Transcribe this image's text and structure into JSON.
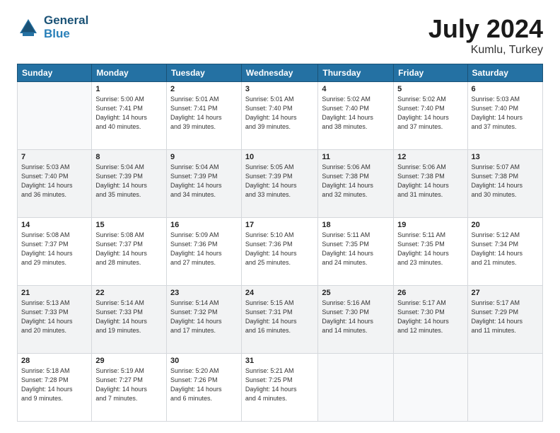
{
  "header": {
    "logo_line1": "General",
    "logo_line2": "Blue",
    "month": "July 2024",
    "location": "Kumlu, Turkey"
  },
  "days_of_week": [
    "Sunday",
    "Monday",
    "Tuesday",
    "Wednesday",
    "Thursday",
    "Friday",
    "Saturday"
  ],
  "weeks": [
    [
      {
        "day": "",
        "info": ""
      },
      {
        "day": "1",
        "info": "Sunrise: 5:00 AM\nSunset: 7:41 PM\nDaylight: 14 hours\nand 40 minutes."
      },
      {
        "day": "2",
        "info": "Sunrise: 5:01 AM\nSunset: 7:41 PM\nDaylight: 14 hours\nand 39 minutes."
      },
      {
        "day": "3",
        "info": "Sunrise: 5:01 AM\nSunset: 7:40 PM\nDaylight: 14 hours\nand 39 minutes."
      },
      {
        "day": "4",
        "info": "Sunrise: 5:02 AM\nSunset: 7:40 PM\nDaylight: 14 hours\nand 38 minutes."
      },
      {
        "day": "5",
        "info": "Sunrise: 5:02 AM\nSunset: 7:40 PM\nDaylight: 14 hours\nand 37 minutes."
      },
      {
        "day": "6",
        "info": "Sunrise: 5:03 AM\nSunset: 7:40 PM\nDaylight: 14 hours\nand 37 minutes."
      }
    ],
    [
      {
        "day": "7",
        "info": "Sunrise: 5:03 AM\nSunset: 7:40 PM\nDaylight: 14 hours\nand 36 minutes."
      },
      {
        "day": "8",
        "info": "Sunrise: 5:04 AM\nSunset: 7:39 PM\nDaylight: 14 hours\nand 35 minutes."
      },
      {
        "day": "9",
        "info": "Sunrise: 5:04 AM\nSunset: 7:39 PM\nDaylight: 14 hours\nand 34 minutes."
      },
      {
        "day": "10",
        "info": "Sunrise: 5:05 AM\nSunset: 7:39 PM\nDaylight: 14 hours\nand 33 minutes."
      },
      {
        "day": "11",
        "info": "Sunrise: 5:06 AM\nSunset: 7:38 PM\nDaylight: 14 hours\nand 32 minutes."
      },
      {
        "day": "12",
        "info": "Sunrise: 5:06 AM\nSunset: 7:38 PM\nDaylight: 14 hours\nand 31 minutes."
      },
      {
        "day": "13",
        "info": "Sunrise: 5:07 AM\nSunset: 7:38 PM\nDaylight: 14 hours\nand 30 minutes."
      }
    ],
    [
      {
        "day": "14",
        "info": "Sunrise: 5:08 AM\nSunset: 7:37 PM\nDaylight: 14 hours\nand 29 minutes."
      },
      {
        "day": "15",
        "info": "Sunrise: 5:08 AM\nSunset: 7:37 PM\nDaylight: 14 hours\nand 28 minutes."
      },
      {
        "day": "16",
        "info": "Sunrise: 5:09 AM\nSunset: 7:36 PM\nDaylight: 14 hours\nand 27 minutes."
      },
      {
        "day": "17",
        "info": "Sunrise: 5:10 AM\nSunset: 7:36 PM\nDaylight: 14 hours\nand 25 minutes."
      },
      {
        "day": "18",
        "info": "Sunrise: 5:11 AM\nSunset: 7:35 PM\nDaylight: 14 hours\nand 24 minutes."
      },
      {
        "day": "19",
        "info": "Sunrise: 5:11 AM\nSunset: 7:35 PM\nDaylight: 14 hours\nand 23 minutes."
      },
      {
        "day": "20",
        "info": "Sunrise: 5:12 AM\nSunset: 7:34 PM\nDaylight: 14 hours\nand 21 minutes."
      }
    ],
    [
      {
        "day": "21",
        "info": "Sunrise: 5:13 AM\nSunset: 7:33 PM\nDaylight: 14 hours\nand 20 minutes."
      },
      {
        "day": "22",
        "info": "Sunrise: 5:14 AM\nSunset: 7:33 PM\nDaylight: 14 hours\nand 19 minutes."
      },
      {
        "day": "23",
        "info": "Sunrise: 5:14 AM\nSunset: 7:32 PM\nDaylight: 14 hours\nand 17 minutes."
      },
      {
        "day": "24",
        "info": "Sunrise: 5:15 AM\nSunset: 7:31 PM\nDaylight: 14 hours\nand 16 minutes."
      },
      {
        "day": "25",
        "info": "Sunrise: 5:16 AM\nSunset: 7:30 PM\nDaylight: 14 hours\nand 14 minutes."
      },
      {
        "day": "26",
        "info": "Sunrise: 5:17 AM\nSunset: 7:30 PM\nDaylight: 14 hours\nand 12 minutes."
      },
      {
        "day": "27",
        "info": "Sunrise: 5:17 AM\nSunset: 7:29 PM\nDaylight: 14 hours\nand 11 minutes."
      }
    ],
    [
      {
        "day": "28",
        "info": "Sunrise: 5:18 AM\nSunset: 7:28 PM\nDaylight: 14 hours\nand 9 minutes."
      },
      {
        "day": "29",
        "info": "Sunrise: 5:19 AM\nSunset: 7:27 PM\nDaylight: 14 hours\nand 7 minutes."
      },
      {
        "day": "30",
        "info": "Sunrise: 5:20 AM\nSunset: 7:26 PM\nDaylight: 14 hours\nand 6 minutes."
      },
      {
        "day": "31",
        "info": "Sunrise: 5:21 AM\nSunset: 7:25 PM\nDaylight: 14 hours\nand 4 minutes."
      },
      {
        "day": "",
        "info": ""
      },
      {
        "day": "",
        "info": ""
      },
      {
        "day": "",
        "info": ""
      }
    ]
  ]
}
